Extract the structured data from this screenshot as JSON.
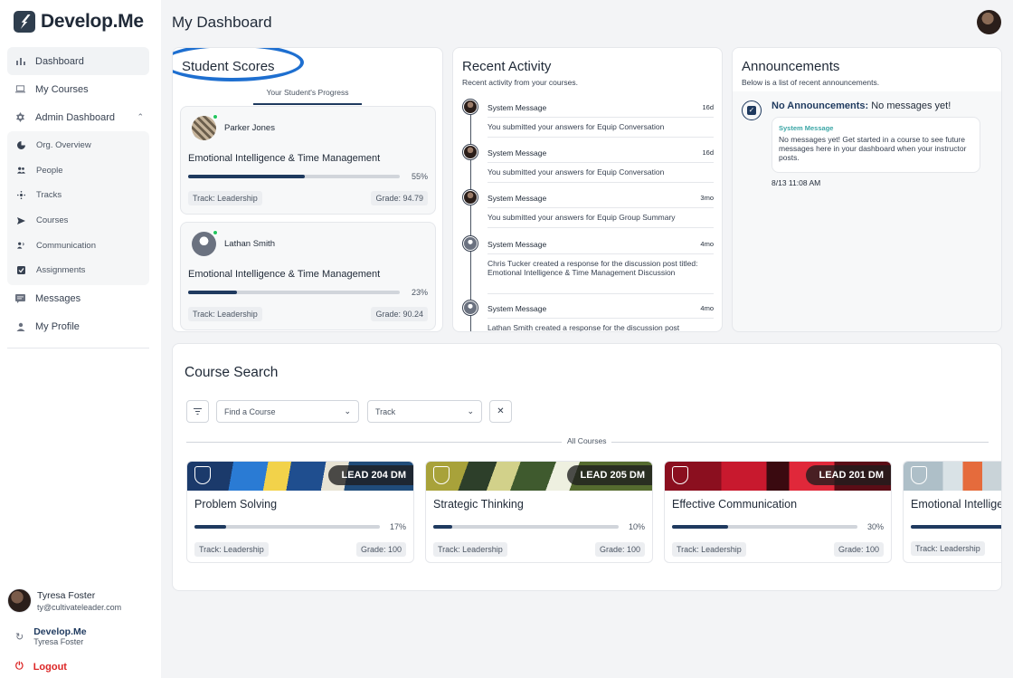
{
  "brand": {
    "name": "Develop.Me"
  },
  "sidebar": {
    "items": [
      {
        "label": "Dashboard",
        "icon": "bar-chart-icon"
      },
      {
        "label": "My Courses",
        "icon": "laptop-icon"
      },
      {
        "label": "Admin Dashboard",
        "icon": "admin-gear-icon"
      }
    ],
    "admin_items": [
      {
        "label": "Org. Overview",
        "icon": "pie-chart-icon"
      },
      {
        "label": "People",
        "icon": "people-icon"
      },
      {
        "label": "Tracks",
        "icon": "tracks-icon"
      },
      {
        "label": "Courses",
        "icon": "send-icon"
      },
      {
        "label": "Communication",
        "icon": "communication-icon"
      },
      {
        "label": "Assignments",
        "icon": "assignment-check-icon"
      }
    ],
    "bottom_items": [
      {
        "label": "Messages",
        "icon": "message-icon"
      },
      {
        "label": "My Profile",
        "icon": "profile-icon"
      }
    ],
    "user": {
      "name": "Tyresa Foster",
      "email": "ty@cultivateleader.com"
    },
    "org": {
      "name": "Develop.Me",
      "user": "Tyresa Foster"
    },
    "logout": "Logout"
  },
  "header": {
    "title": "My Dashboard"
  },
  "student_scores": {
    "title": "Student Scores",
    "tab": "Your Student's Progress",
    "students": [
      {
        "name": "Parker Jones",
        "course": "Emotional Intelligence & Time Management",
        "progress_pct": 55,
        "progress_label": "55%",
        "track": "Track: Leadership",
        "grade": "Grade: 94.79"
      },
      {
        "name": "Lathan Smith",
        "course": "Emotional Intelligence & Time Management",
        "progress_pct": 23,
        "progress_label": "23%",
        "track": "Track: Leadership",
        "grade": "Grade: 90.24"
      }
    ]
  },
  "recent_activity": {
    "title": "Recent Activity",
    "subtitle": "Recent activity from your courses.",
    "items": [
      {
        "label": "System Message",
        "time": "16d",
        "body": "You submitted your answers for Equip Conversation",
        "avatar": "photo"
      },
      {
        "label": "System Message",
        "time": "16d",
        "body": "You submitted your answers for Equip Conversation",
        "avatar": "photo"
      },
      {
        "label": "System Message",
        "time": "3mo",
        "body": "You submitted your answers for Equip Group Summary",
        "avatar": "photo"
      },
      {
        "label": "System Message",
        "time": "4mo",
        "body": "Chris Tucker created a response for the discussion post titled: Emotional Intelligence & Time Management Discussion",
        "avatar": "generic"
      },
      {
        "label": "System Message",
        "time": "4mo",
        "body": "Lathan Smith created a response for the discussion post",
        "avatar": "generic"
      }
    ]
  },
  "announcements": {
    "title": "Announcements",
    "subtitle": "Below is a list of recent announcements.",
    "item_title_bold": "No Announcements:",
    "item_title_rest": " No messages yet!",
    "message_label": "System Message",
    "message_body": "No messages yet! Get started in a course to see future messages here in your dashboard when your instructor posts.",
    "timestamp": "8/13 11:08 AM"
  },
  "course_search": {
    "title": "Course Search",
    "find_placeholder": "Find a Course",
    "track_placeholder": "Track",
    "all_courses_label": "All Courses",
    "courses": [
      {
        "code": "LEAD 204 DM",
        "title": "Problem Solving",
        "progress_pct": 17,
        "progress_label": "17%",
        "track": "Track: Leadership",
        "grade": "Grade: 100"
      },
      {
        "code": "LEAD 205 DM",
        "title": "Strategic Thinking",
        "progress_pct": 10,
        "progress_label": "10%",
        "track": "Track: Leadership",
        "grade": "Grade: 100"
      },
      {
        "code": "LEAD 201 DM",
        "title": "Effective Communication",
        "progress_pct": 30,
        "progress_label": "30%",
        "track": "Track: Leadership",
        "grade": "Grade: 100"
      },
      {
        "code": "",
        "title": "Emotional Intellige",
        "progress_pct": 72,
        "progress_label": "",
        "track": "Track: Leadership",
        "grade": ""
      }
    ]
  },
  "colors": {
    "accent": "#1f3a5f",
    "highlight_ring": "#1e6fd0",
    "logout": "#dc2626"
  }
}
